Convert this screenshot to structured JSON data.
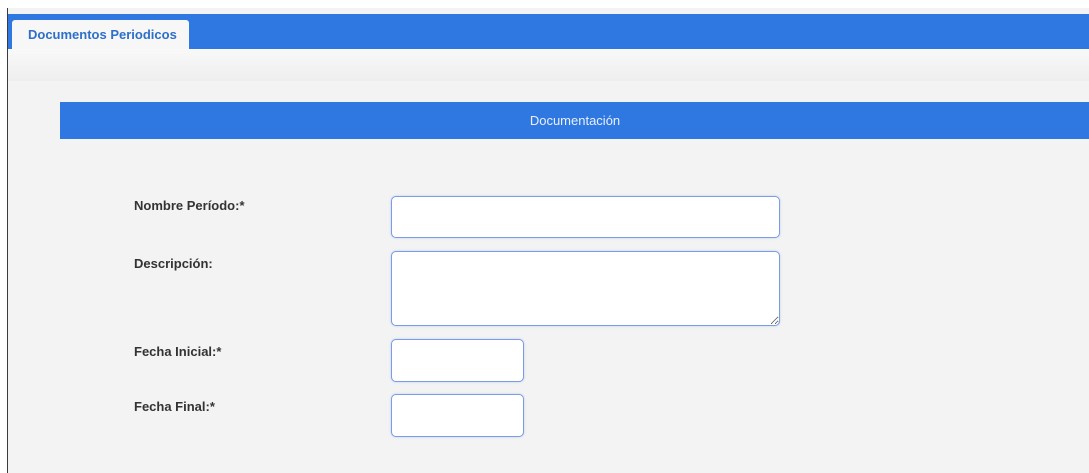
{
  "tabs": [
    {
      "label": "Documentos Periodicos"
    }
  ],
  "section": {
    "title": "Documentación"
  },
  "form": {
    "nombre_periodo": {
      "label": "Nombre Período:*",
      "value": ""
    },
    "descripcion": {
      "label": "Descripción:",
      "value": ""
    },
    "fecha_inicial": {
      "label": "Fecha Inicial:*",
      "value": ""
    },
    "fecha_final": {
      "label": "Fecha Final:*",
      "value": ""
    }
  },
  "colors": {
    "accent": "#2f77e1",
    "background": "#f3f3f3",
    "field_border": "#7a9de6"
  }
}
